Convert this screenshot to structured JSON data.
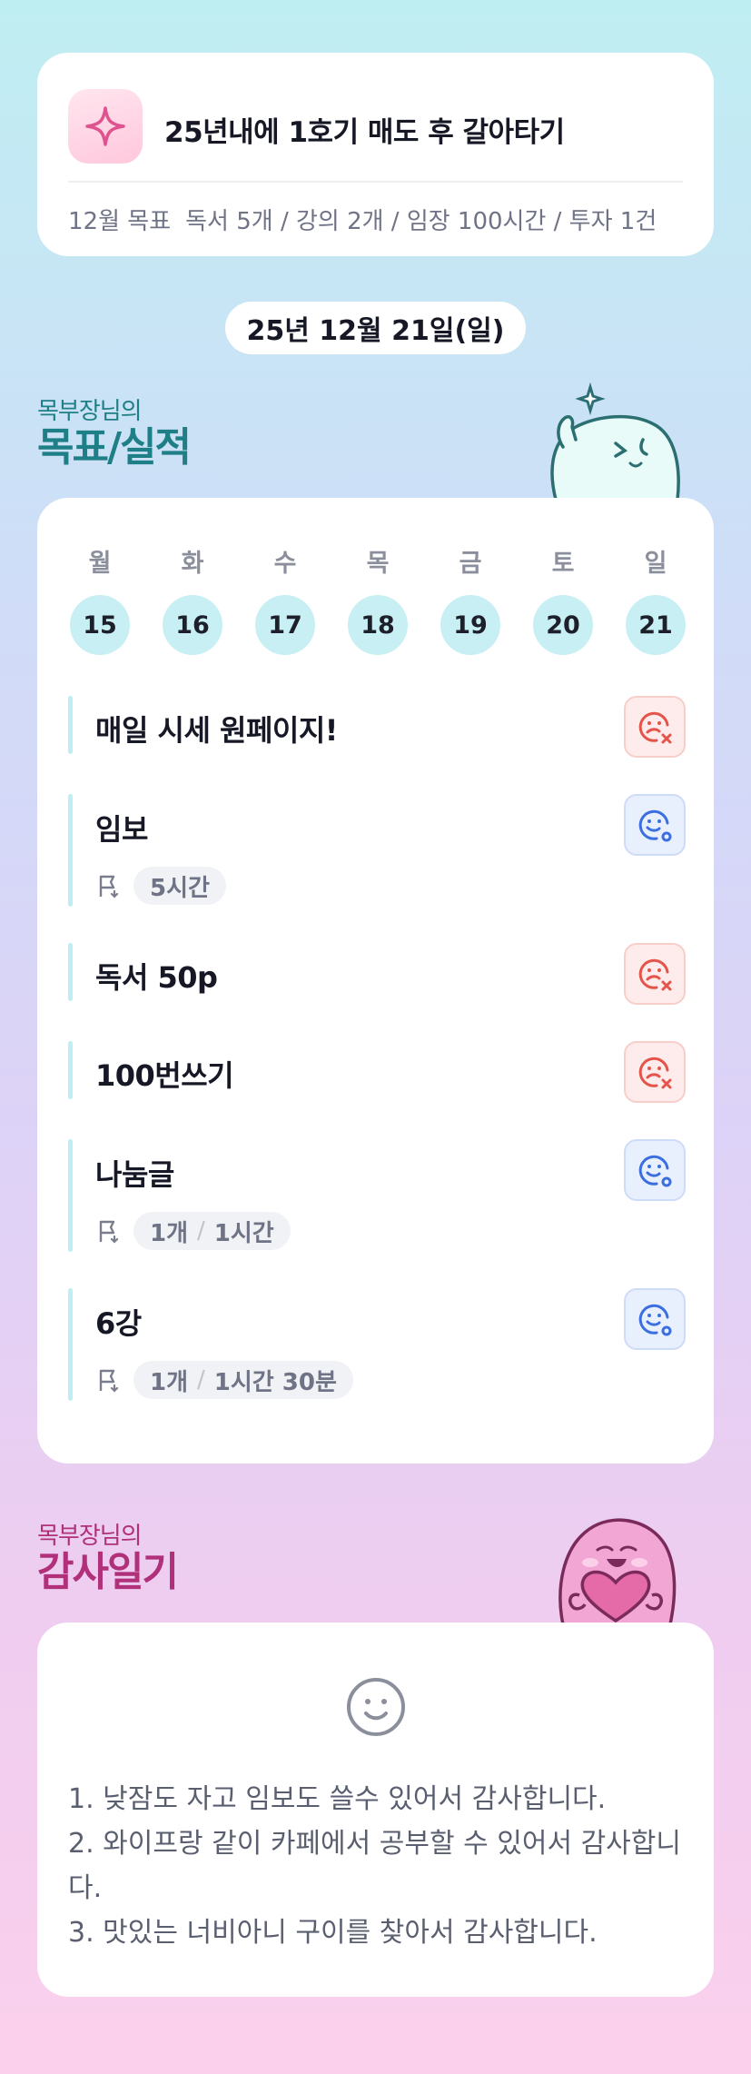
{
  "goal": {
    "title": "25년내에 1호기 매도 후 갈아타기",
    "monthly_label": "12월 목표",
    "monthly_text": "독서 5개 / 강의 2개 / 임장 100시간 / 투자 1건"
  },
  "date_label": "25년 12월 21일(일)",
  "performance_section": {
    "subtitle": "목부장님의",
    "title": "목표/실적"
  },
  "week": [
    {
      "day": "월",
      "date": "15"
    },
    {
      "day": "화",
      "date": "16"
    },
    {
      "day": "수",
      "date": "17"
    },
    {
      "day": "목",
      "date": "18"
    },
    {
      "day": "금",
      "date": "19"
    },
    {
      "day": "토",
      "date": "20"
    },
    {
      "day": "일",
      "date": "21"
    }
  ],
  "tasks": [
    {
      "name": "매일 시세 원페이지!",
      "status": "fail"
    },
    {
      "name": "임보",
      "status": "ok",
      "meta": [
        "5시간"
      ]
    },
    {
      "name": "독서 50p",
      "status": "fail"
    },
    {
      "name": "100번쓰기",
      "status": "fail"
    },
    {
      "name": "나눔글",
      "status": "ok",
      "meta": [
        "1개",
        "1시간"
      ]
    },
    {
      "name": "6강",
      "status": "ok",
      "meta": [
        "1개",
        "1시간 30분"
      ]
    }
  ],
  "gratitude_section": {
    "subtitle": "목부장님의",
    "title": "감사일기"
  },
  "gratitude": {
    "lines": [
      "1. 낮잠도 자고 임보도 쓸수 있어서 감사합니다.",
      "2. 와이프랑 같이 카페에서 공부할 수 있어서 감사합니다.",
      "3. 맛있는 너비아니 구이를 찾아서 감사합니다."
    ]
  },
  "colors": {
    "accent_teal": "#1f7f86",
    "accent_pink": "#b0307a",
    "fail_red": "#e5534b",
    "ok_blue": "#3b6fe0"
  },
  "icons": {
    "goal": "sparkle-icon",
    "fail": "sad-face-x-icon",
    "ok": "smile-face-o-icon",
    "meta": "flag-icon",
    "gratitude": "smile-icon"
  }
}
